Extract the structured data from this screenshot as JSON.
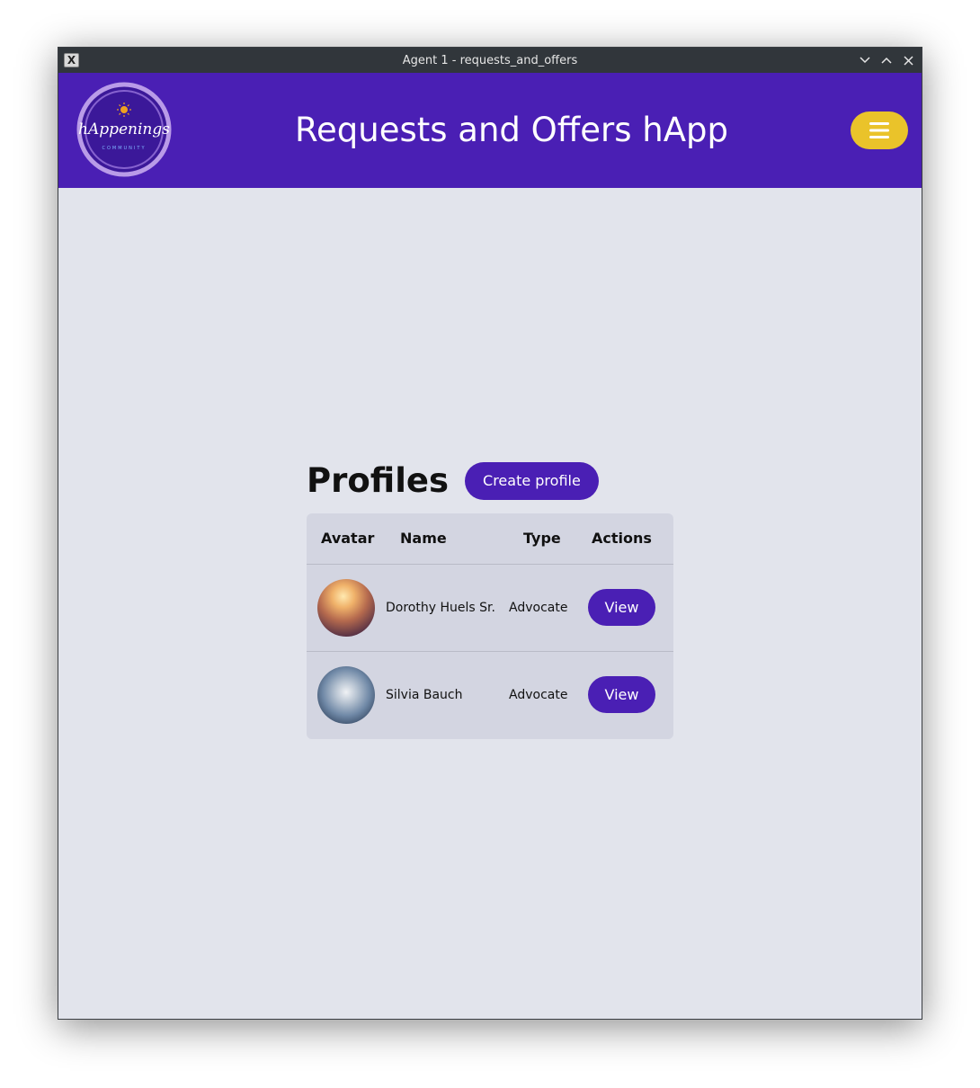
{
  "window": {
    "title": "Agent 1 - requests_and_offers"
  },
  "header": {
    "logo_text": "hAppenings",
    "logo_subtext": "COMMUNITY",
    "title": "Requests and Offers hApp"
  },
  "main": {
    "heading": "Profiles",
    "create_button_label": "Create profile",
    "table": {
      "columns": [
        "Avatar",
        "Name",
        "Type",
        "Actions"
      ],
      "rows": [
        {
          "name": "Dorothy Huels Sr.",
          "type": "Advocate",
          "action_label": "View"
        },
        {
          "name": "Silvia Bauch",
          "type": "Advocate",
          "action_label": "View"
        }
      ]
    }
  },
  "colors": {
    "header_bg": "#4a1fb4",
    "accent": "#4a1fb4",
    "menu_button": "#eac32a",
    "page_bg": "#e2e4ec",
    "table_bg": "#d3d5e1"
  }
}
